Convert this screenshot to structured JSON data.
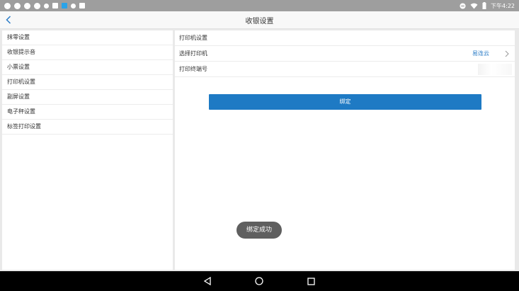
{
  "status_bar": {
    "time": "下午4:22",
    "icons": [
      "qq-icon",
      "qq-icon",
      "qq-icon",
      "qq-icon",
      "dot-icon",
      "image-icon",
      "app-icon",
      "settings-icon",
      "download-icon"
    ],
    "right_icons": [
      "do-not-disturb-icon",
      "wifi-icon",
      "battery-icon"
    ]
  },
  "header": {
    "title": "收银设置",
    "back_icon": "chevron-left-icon"
  },
  "sidebar": {
    "items": [
      {
        "label": "抹零设置"
      },
      {
        "label": "收银提示音"
      },
      {
        "label": "小票设置"
      },
      {
        "label": "打印机设置"
      },
      {
        "label": "副屏设置"
      },
      {
        "label": "电子秤设置"
      },
      {
        "label": "标签打印设置"
      }
    ]
  },
  "settings": {
    "section_title": "打印机设置",
    "select_printer_label": "选择打印机",
    "select_printer_value": "易连云",
    "terminal_label": "打印终端号",
    "bind_button": "绑定"
  },
  "toast": {
    "text": "绑定成功"
  },
  "nav_bar": {
    "icons": [
      "back-triangle-icon",
      "home-circle-icon",
      "recents-square-icon"
    ]
  },
  "colors": {
    "accent": "#1e7ac4",
    "status_bar": "#9e9e9e",
    "nav_bar": "#000000"
  }
}
